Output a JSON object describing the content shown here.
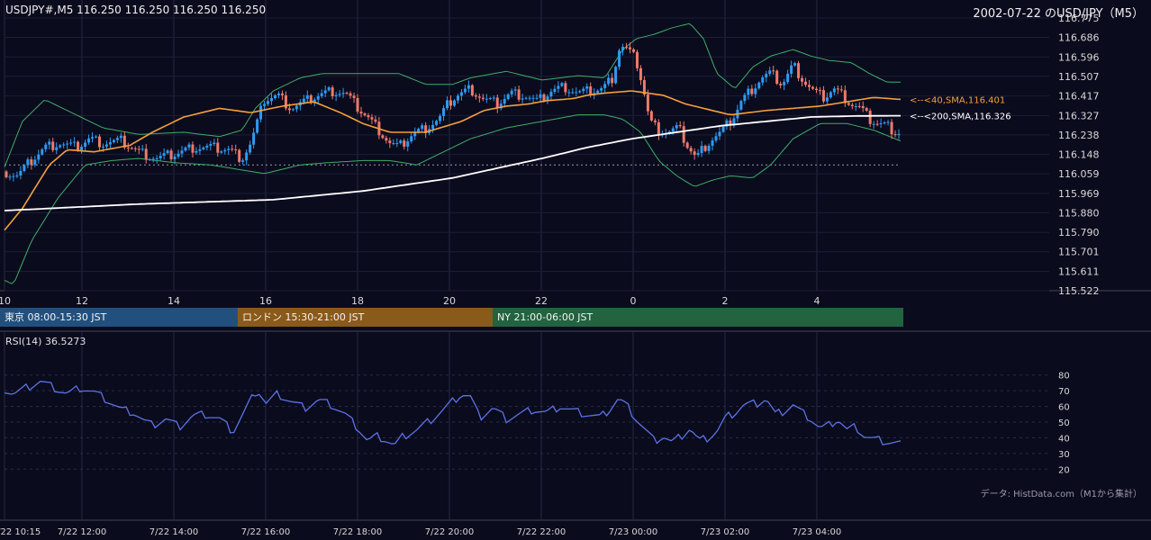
{
  "header": {
    "symbol_line": "USDJPY#,M5 116.250 116.250 116.250 116.250",
    "right_title": "2002-07-22 のUSD/JPY（M5）"
  },
  "colors": {
    "background": "#0b0b1e",
    "candle_up": "#2e9bf0",
    "candle_down": "#ee7a6a",
    "sma40": "#f5a03a",
    "sma200": "#ffffff",
    "bollinger": "#3fae66",
    "rsi": "#5b73e6",
    "session_tokyo": "#22507e",
    "session_london": "#8a5a1a",
    "session_ny": "#226340"
  },
  "sessions": [
    {
      "label": "東京 08:00-15:30 JST"
    },
    {
      "label": "ロンドン 15:30-21:00 JST"
    },
    {
      "label": "NY 21:00-06:00 JST"
    }
  ],
  "rsi_label": "RSI(14) 36.5273",
  "credit": "データ: HistData.com（M1から集計）",
  "annotations": {
    "sma40": "<--<40,SMA,116.401",
    "sma200": "<--<200,SMA,116.326"
  },
  "chart_data": [
    {
      "type": "candlestick",
      "ylim": [
        115.522,
        116.775
      ],
      "y_ticks": [
        "116.775",
        "116.686",
        "116.596",
        "116.507",
        "116.417",
        "116.327",
        "116.238",
        "116.148",
        "116.059",
        "115.969",
        "115.880",
        "115.790",
        "115.701",
        "115.611",
        "115.522"
      ],
      "x_ticks": [
        "10",
        "12",
        "14",
        "16",
        "18",
        "20",
        "22",
        "0",
        "2",
        "4"
      ],
      "reference_line": 116.1,
      "sma40_anchors": [
        [
          0,
          115.8
        ],
        [
          20,
          115.9
        ],
        [
          50,
          116.1
        ],
        [
          70,
          116.17
        ],
        [
          100,
          116.16
        ],
        [
          140,
          116.19
        ],
        [
          165,
          116.25
        ],
        [
          200,
          116.32
        ],
        [
          240,
          116.36
        ],
        [
          275,
          116.34
        ],
        [
          310,
          116.37
        ],
        [
          345,
          116.39
        ],
        [
          375,
          116.34
        ],
        [
          400,
          116.29
        ],
        [
          430,
          116.25
        ],
        [
          470,
          116.25
        ],
        [
          510,
          116.3
        ],
        [
          535,
          116.35
        ],
        [
          560,
          116.37
        ],
        [
          585,
          116.38
        ],
        [
          605,
          116.395
        ],
        [
          620,
          116.4
        ],
        [
          635,
          116.405
        ],
        [
          650,
          116.42
        ],
        [
          670,
          116.43
        ],
        [
          700,
          116.44
        ],
        [
          735,
          116.42
        ],
        [
          760,
          116.38
        ],
        [
          790,
          116.35
        ],
        [
          810,
          116.33
        ],
        [
          830,
          116.34
        ],
        [
          850,
          116.35
        ],
        [
          880,
          116.36
        ],
        [
          910,
          116.37
        ],
        [
          940,
          116.39
        ],
        [
          970,
          116.41
        ],
        [
          1000,
          116.401
        ]
      ],
      "sma200_anchors": [
        [
          0,
          115.89
        ],
        [
          150,
          115.92
        ],
        [
          300,
          115.94
        ],
        [
          400,
          115.98
        ],
        [
          500,
          116.04
        ],
        [
          600,
          116.13
        ],
        [
          650,
          116.18
        ],
        [
          700,
          116.22
        ],
        [
          750,
          116.25
        ],
        [
          800,
          116.28
        ],
        [
          850,
          116.3
        ],
        [
          900,
          116.32
        ],
        [
          950,
          116.325
        ],
        [
          1000,
          116.326
        ]
      ],
      "bb_upper_anchors": [
        [
          0,
          116.09
        ],
        [
          20,
          116.3
        ],
        [
          45,
          116.4
        ],
        [
          70,
          116.35
        ],
        [
          110,
          116.27
        ],
        [
          150,
          116.24
        ],
        [
          200,
          116.25
        ],
        [
          240,
          116.23
        ],
        [
          265,
          116.26
        ],
        [
          280,
          116.36
        ],
        [
          300,
          116.44
        ],
        [
          330,
          116.5
        ],
        [
          355,
          116.52
        ],
        [
          380,
          116.52
        ],
        [
          410,
          116.52
        ],
        [
          440,
          116.52
        ],
        [
          470,
          116.47
        ],
        [
          500,
          116.47
        ],
        [
          520,
          116.5
        ],
        [
          560,
          116.53
        ],
        [
          600,
          116.49
        ],
        [
          640,
          116.51
        ],
        [
          670,
          116.5
        ],
        [
          690,
          116.63
        ],
        [
          705,
          116.68
        ],
        [
          725,
          116.7
        ],
        [
          745,
          116.73
        ],
        [
          765,
          116.75
        ],
        [
          780,
          116.68
        ],
        [
          795,
          116.52
        ],
        [
          815,
          116.45
        ],
        [
          835,
          116.55
        ],
        [
          855,
          116.6
        ],
        [
          880,
          116.63
        ],
        [
          900,
          116.6
        ],
        [
          920,
          116.58
        ],
        [
          945,
          116.57
        ],
        [
          965,
          116.52
        ],
        [
          985,
          116.48
        ],
        [
          1000,
          116.48
        ]
      ],
      "bb_lower_anchors": [
        [
          0,
          115.57
        ],
        [
          10,
          115.55
        ],
        [
          30,
          115.75
        ],
        [
          60,
          115.95
        ],
        [
          90,
          116.1
        ],
        [
          120,
          116.12
        ],
        [
          150,
          116.13
        ],
        [
          190,
          116.11
        ],
        [
          230,
          116.1
        ],
        [
          260,
          116.08
        ],
        [
          290,
          116.06
        ],
        [
          330,
          116.1
        ],
        [
          360,
          116.11
        ],
        [
          400,
          116.12
        ],
        [
          430,
          116.12
        ],
        [
          460,
          116.1
        ],
        [
          490,
          116.16
        ],
        [
          520,
          116.22
        ],
        [
          560,
          116.27
        ],
        [
          600,
          116.3
        ],
        [
          640,
          116.33
        ],
        [
          670,
          116.33
        ],
        [
          690,
          116.31
        ],
        [
          710,
          116.25
        ],
        [
          730,
          116.12
        ],
        [
          750,
          116.05
        ],
        [
          770,
          116.0
        ],
        [
          790,
          116.03
        ],
        [
          810,
          116.05
        ],
        [
          835,
          116.04
        ],
        [
          855,
          116.1
        ],
        [
          880,
          116.22
        ],
        [
          910,
          116.29
        ],
        [
          940,
          116.29
        ],
        [
          970,
          116.26
        ],
        [
          1000,
          116.21
        ]
      ],
      "price_anchors": [
        [
          0,
          116.07
        ],
        [
          15,
          116.05
        ],
        [
          30,
          116.12
        ],
        [
          45,
          116.18
        ],
        [
          60,
          116.2
        ],
        [
          80,
          116.18
        ],
        [
          95,
          116.22
        ],
        [
          110,
          116.2
        ],
        [
          130,
          116.21
        ],
        [
          150,
          116.16
        ],
        [
          170,
          116.13
        ],
        [
          190,
          116.15
        ],
        [
          210,
          116.18
        ],
        [
          230,
          116.18
        ],
        [
          250,
          116.17
        ],
        [
          265,
          116.13
        ],
        [
          275,
          116.2
        ],
        [
          290,
          116.4
        ],
        [
          305,
          116.42
        ],
        [
          320,
          116.36
        ],
        [
          335,
          116.39
        ],
        [
          350,
          116.42
        ],
        [
          365,
          116.44
        ],
        [
          380,
          116.43
        ],
        [
          395,
          116.36
        ],
        [
          405,
          116.32
        ],
        [
          418,
          116.26
        ],
        [
          430,
          116.2
        ],
        [
          440,
          116.18
        ],
        [
          455,
          116.24
        ],
        [
          470,
          116.27
        ],
        [
          485,
          116.31
        ],
        [
          495,
          116.38
        ],
        [
          505,
          116.42
        ],
        [
          520,
          116.45
        ],
        [
          535,
          116.4
        ],
        [
          550,
          116.38
        ],
        [
          565,
          116.43
        ],
        [
          580,
          116.42
        ],
        [
          595,
          116.39
        ],
        [
          610,
          116.44
        ],
        [
          625,
          116.46
        ],
        [
          640,
          116.43
        ],
        [
          655,
          116.44
        ],
        [
          668,
          116.45
        ],
        [
          678,
          116.5
        ],
        [
          687,
          116.65
        ],
        [
          695,
          116.63
        ],
        [
          705,
          116.58
        ],
        [
          712,
          116.47
        ],
        [
          720,
          116.3
        ],
        [
          730,
          116.26
        ],
        [
          740,
          116.25
        ],
        [
          752,
          116.27
        ],
        [
          762,
          116.19
        ],
        [
          772,
          116.13
        ],
        [
          780,
          116.18
        ],
        [
          790,
          116.22
        ],
        [
          800,
          116.25
        ],
        [
          812,
          116.31
        ],
        [
          822,
          116.39
        ],
        [
          832,
          116.44
        ],
        [
          845,
          116.5
        ],
        [
          855,
          116.52
        ],
        [
          868,
          116.47
        ],
        [
          880,
          116.56
        ],
        [
          888,
          116.51
        ],
        [
          895,
          116.47
        ],
        [
          905,
          116.43
        ],
        [
          915,
          116.41
        ],
        [
          925,
          116.45
        ],
        [
          935,
          116.42
        ],
        [
          945,
          116.38
        ],
        [
          955,
          116.36
        ],
        [
          965,
          116.31
        ],
        [
          975,
          116.29
        ],
        [
          985,
          116.28
        ],
        [
          995,
          116.25
        ]
      ]
    },
    {
      "type": "line",
      "name": "RSI(14)",
      "ylim": [
        15,
        85
      ],
      "y_ticks": [
        "80",
        "70",
        "60",
        "50",
        "40",
        "30",
        "20"
      ],
      "x_ticks": [
        "7/22 10:15",
        "7/22 12:00",
        "7/22 14:00",
        "7/22 16:00",
        "7/22 18:00",
        "7/22 20:00",
        "7/22 22:00",
        "7/23 00:00",
        "7/23 02:00",
        "7/23 04:00"
      ],
      "anchors": [
        [
          0,
          71
        ],
        [
          10,
          68
        ],
        [
          25,
          72
        ],
        [
          40,
          76
        ],
        [
          55,
          72
        ],
        [
          70,
          68
        ],
        [
          85,
          72
        ],
        [
          100,
          69
        ],
        [
          115,
          64
        ],
        [
          130,
          58
        ],
        [
          145,
          56
        ],
        [
          155,
          51
        ],
        [
          165,
          48
        ],
        [
          180,
          52
        ],
        [
          195,
          47
        ],
        [
          210,
          54
        ],
        [
          225,
          55
        ],
        [
          240,
          52
        ],
        [
          255,
          44
        ],
        [
          270,
          59
        ],
        [
          282,
          71
        ],
        [
          292,
          62
        ],
        [
          305,
          68
        ],
        [
          320,
          63
        ],
        [
          335,
          59
        ],
        [
          350,
          64
        ],
        [
          365,
          61
        ],
        [
          380,
          55
        ],
        [
          395,
          46
        ],
        [
          405,
          38
        ],
        [
          415,
          41
        ],
        [
          425,
          39
        ],
        [
          435,
          35
        ],
        [
          445,
          41
        ],
        [
          460,
          45
        ],
        [
          475,
          51
        ],
        [
          490,
          58
        ],
        [
          500,
          63
        ],
        [
          510,
          68
        ],
        [
          520,
          66
        ],
        [
          530,
          53
        ],
        [
          545,
          59
        ],
        [
          560,
          52
        ],
        [
          575,
          55
        ],
        [
          590,
          58
        ],
        [
          605,
          56
        ],
        [
          620,
          60
        ],
        [
          635,
          57
        ],
        [
          650,
          55
        ],
        [
          665,
          53
        ],
        [
          675,
          58
        ],
        [
          685,
          65
        ],
        [
          695,
          60
        ],
        [
          705,
          52
        ],
        [
          715,
          45
        ],
        [
          725,
          38
        ],
        [
          735,
          41
        ],
        [
          745,
          37
        ],
        [
          755,
          41
        ],
        [
          765,
          46
        ],
        [
          775,
          38
        ],
        [
          785,
          40
        ],
        [
          795,
          44
        ],
        [
          805,
          53
        ],
        [
          815,
          56
        ],
        [
          825,
          61
        ],
        [
          840,
          62
        ],
        [
          850,
          65
        ],
        [
          860,
          55
        ],
        [
          870,
          57
        ],
        [
          880,
          61
        ],
        [
          890,
          56
        ],
        [
          900,
          52
        ],
        [
          910,
          46
        ],
        [
          920,
          48
        ],
        [
          930,
          52
        ],
        [
          940,
          45
        ],
        [
          950,
          47
        ],
        [
          960,
          41
        ],
        [
          970,
          39
        ],
        [
          980,
          38
        ],
        [
          990,
          37
        ],
        [
          1000,
          36.5
        ]
      ]
    }
  ]
}
